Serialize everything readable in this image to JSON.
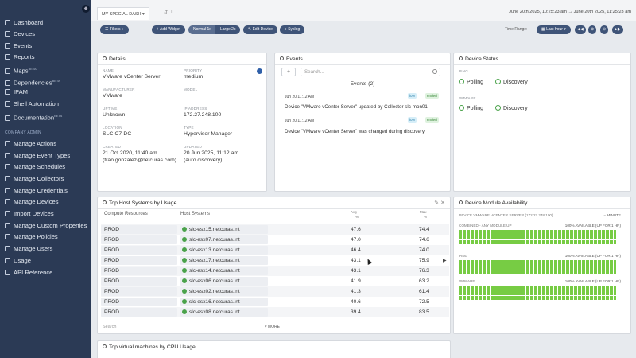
{
  "sidebar": {
    "items": [
      {
        "label": "Dashboard",
        "icon": "dashboard-icon"
      },
      {
        "label": "Devices",
        "icon": "devices-icon"
      },
      {
        "label": "Events",
        "icon": "events-icon"
      },
      {
        "label": "Reports",
        "icon": "reports-icon"
      },
      {
        "label": "Maps",
        "sup": "BETA",
        "icon": "maps-icon"
      },
      {
        "label": "Dependencies",
        "sup": "BETA",
        "icon": "dependencies-icon"
      },
      {
        "label": "IPAM",
        "icon": "ipam-icon"
      },
      {
        "label": "Shell Automation",
        "icon": "shell-icon"
      },
      {
        "label": "Documentation",
        "sup": "BETA",
        "icon": "documentation-icon"
      }
    ],
    "section_title": "COMPANY ADMIN",
    "admin_items": [
      {
        "label": "Manage Actions",
        "icon": "actions-icon"
      },
      {
        "label": "Manage Event Types",
        "icon": "event-types-icon"
      },
      {
        "label": "Manage Schedules",
        "icon": "schedules-icon"
      },
      {
        "label": "Manage Collectors",
        "icon": "collectors-icon"
      },
      {
        "label": "Manage Credentials",
        "icon": "credentials-icon"
      },
      {
        "label": "Manage Devices",
        "icon": "manage-devices-icon"
      },
      {
        "label": "Import Devices",
        "icon": "import-icon"
      },
      {
        "label": "Manage Custom Properties",
        "icon": "properties-icon"
      },
      {
        "label": "Manage Policies",
        "icon": "policies-icon"
      },
      {
        "label": "Manage Users",
        "icon": "users-icon"
      },
      {
        "label": "Usage",
        "icon": "usage-icon"
      },
      {
        "label": "API Reference",
        "icon": "api-icon"
      }
    ]
  },
  "topbar": {
    "tab_label": "MY SPECIAL DASH ▾",
    "date_range": "June 20th 2025, 10:25:23 am → June 20th 2025, 11:25:23 am"
  },
  "toolbar": {
    "filters": "Filters",
    "add_widget": "+ Add Widget",
    "normal": "Normal 1x",
    "large": "Large 2x",
    "edit_device": "Edit Device",
    "syslog": "Syslog",
    "time_range_label": "Time Range:",
    "time_range_value": "Last hour ▾"
  },
  "details": {
    "title": "Details",
    "fields": [
      {
        "label": "NAME",
        "value": "VMware vCenter Server"
      },
      {
        "label": "PRIORITY",
        "value": "medium"
      },
      {
        "label": "MANUFACTURER",
        "value": "VMware"
      },
      {
        "label": "MODEL",
        "value": ""
      },
      {
        "label": "UPTIME",
        "value": "Unknown"
      },
      {
        "label": "IP ADDRESS",
        "value": "172.27.248.100"
      },
      {
        "label": "LOCATION",
        "value": "SLC-C7-DC"
      },
      {
        "label": "TYPE",
        "value": "Hypervisor Manager"
      },
      {
        "label": "CREATED",
        "value": "21 Oct 2020, 11:40 am",
        "value2": "(fran.gonzalez@netcuras.com)"
      },
      {
        "label": "UPDATED",
        "value": "20 Jun 2025, 11:12 am",
        "value2": "(auto discovery)"
      }
    ]
  },
  "events": {
    "title": "Events",
    "search_placeholder": "Search...",
    "count_label": "Events (2)",
    "items": [
      {
        "time": "Jun 20 11:12 AM",
        "severity": "low",
        "state": "ended",
        "message": "Device \"VMware vCenter Server\" updated by Collector slc-mon01"
      },
      {
        "time": "Jun 20 11:12 AM",
        "severity": "low",
        "state": "ended",
        "message": "Device \"VMware vCenter Server\" was changed during discovery"
      }
    ]
  },
  "device_status": {
    "title": "Device Status",
    "groups": [
      {
        "label": "PING",
        "polling": "Polling",
        "discovery": "Discovery"
      },
      {
        "label": "VMWARE",
        "polling": "Polling",
        "discovery": "Discovery"
      }
    ]
  },
  "host_systems": {
    "title": "Top Host Systems by Usage",
    "columns": [
      "Compute Resources",
      "Host Systems",
      "Avg %",
      "Max %"
    ],
    "col_sub_avg": "Avg",
    "col_sub_max": "Max",
    "rows": [
      {
        "resource": "PROD",
        "host": "slc-esx15.netcuras.int",
        "avg": "47.6",
        "max": "74.4"
      },
      {
        "resource": "PROD",
        "host": "slc-esx07.netcuras.int",
        "avg": "47.0",
        "max": "74.6"
      },
      {
        "resource": "PROD",
        "host": "slc-esx13.netcuras.int",
        "avg": "46.4",
        "max": "74.0"
      },
      {
        "resource": "PROD",
        "host": "slc-esx17.netcuras.int",
        "avg": "43.1",
        "max": "75.9"
      },
      {
        "resource": "PROD",
        "host": "slc-esx14.netcuras.int",
        "avg": "43.1",
        "max": "76.3"
      },
      {
        "resource": "PROD",
        "host": "slc-esx06.netcuras.int",
        "avg": "41.9",
        "max": "63.2"
      },
      {
        "resource": "PROD",
        "host": "slc-esx02.netcuras.int",
        "avg": "41.3",
        "max": "61.4"
      },
      {
        "resource": "PROD",
        "host": "slc-esx16.netcuras.int",
        "avg": "40.6",
        "max": "72.5"
      },
      {
        "resource": "PROD",
        "host": "slc-esx08.netcuras.int",
        "avg": "39.4",
        "max": "83.5"
      }
    ],
    "search_label": "Search",
    "more_label": "▾ MORE"
  },
  "module_availability": {
    "title": "Device Module Availability",
    "device_label": "DEVICE VMWARE VCENTER SERVER (172.27.248.100)",
    "interval": "= MINUTE",
    "modules": [
      {
        "label": "COMBINED - ANY MODULE UP",
        "availability": "100% AVAILABLE (UP FOR 1 HR)"
      },
      {
        "label": "PING",
        "availability": "100% AVAILABLE (UP FOR 1 HR)"
      },
      {
        "label": "VMWARE",
        "availability": "100% AVAILABLE (UP FOR 1 HR)"
      }
    ]
  },
  "vm_cpu": {
    "title": "Top virtual machines by CPU Usage"
  },
  "colors": {
    "sidebar_bg": "#2b3a55",
    "toolbar_btn": "#3f5478",
    "ok_green": "#4aa24a",
    "avail_green": "#77cc44"
  }
}
